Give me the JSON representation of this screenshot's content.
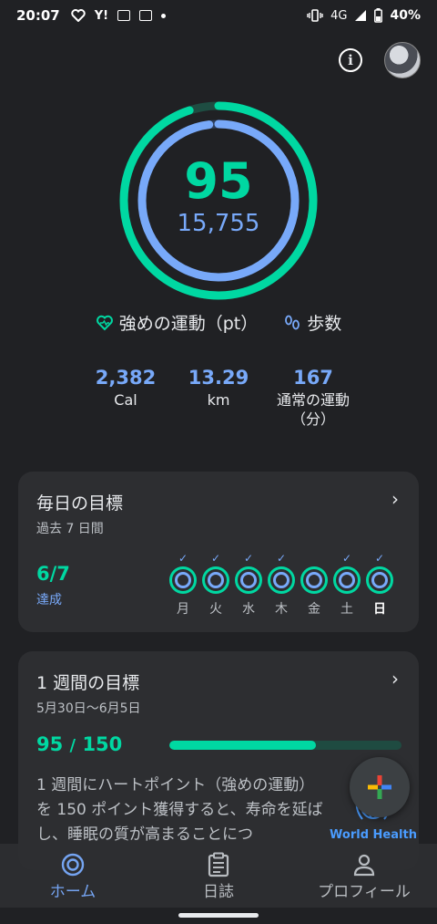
{
  "status_bar": {
    "time": "20:07",
    "network": "4G",
    "battery": "40%",
    "icons": [
      "heart-icon",
      "yahoo-icon",
      "notification-icon",
      "notification-icon",
      "dot-icon",
      "vibrate-icon",
      "signal-icon",
      "battery-icon"
    ]
  },
  "header": {
    "info_icon": "info-icon",
    "avatar_icon": "avatar"
  },
  "rings": {
    "heart_points": "95",
    "steps": "15,755",
    "heart_points_progress": 0.95,
    "steps_progress": 0.98
  },
  "legend": {
    "heart_label": "強めの運動（pt）",
    "steps_label": "歩数"
  },
  "stats": [
    {
      "value": "2,382",
      "label": "Cal"
    },
    {
      "value": "13.29",
      "label": "km"
    },
    {
      "value": "167",
      "label": "通常の運動（分）"
    }
  ],
  "daily_goal": {
    "title": "毎日の目標",
    "subtitle": "過去 7 日間",
    "achieved": "6/7",
    "achieved_label": "達成",
    "days": [
      {
        "label": "月",
        "checked": true
      },
      {
        "label": "火",
        "checked": true
      },
      {
        "label": "水",
        "checked": true
      },
      {
        "label": "木",
        "checked": true
      },
      {
        "label": "金",
        "checked": false
      },
      {
        "label": "土",
        "checked": true
      },
      {
        "label": "日",
        "checked": true
      }
    ]
  },
  "weekly_goal": {
    "title": "1 週間の目標",
    "date_range": "5月30日～6月5日",
    "current": "95",
    "separator": "/",
    "target": "150",
    "progress": 0.633,
    "description": "1 週間にハートポイント（強めの運動）を 150 ポイント獲得すると、寿命を延ばし、睡眠の質が高まることにつ",
    "badge_label": "World Health"
  },
  "fab": {
    "icon": "plus-icon"
  },
  "bottom_nav": [
    {
      "label": "ホーム",
      "icon": "home-icon",
      "active": true
    },
    {
      "label": "日誌",
      "icon": "journal-icon",
      "active": false
    },
    {
      "label": "プロフィール",
      "icon": "profile-icon",
      "active": false
    }
  ],
  "colors": {
    "background": "#202124",
    "card": "#2d2e31",
    "green": "#00d8a2",
    "blue": "#78a9f9"
  }
}
